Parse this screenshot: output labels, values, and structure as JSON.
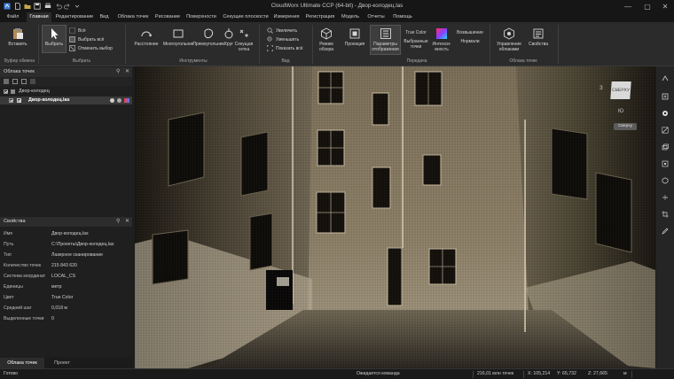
{
  "window": {
    "title": "CloudWorx Ultimate CCP (64-bit) - Двор-колодец.las",
    "minimize": "—",
    "maximize": "▢",
    "close": "✕"
  },
  "menu": {
    "tabs": [
      "Файл",
      "Главная",
      "Редактирование",
      "Вид",
      "Облака точек",
      "Рисование",
      "Поверхности",
      "Секущие плоскости",
      "Измерения",
      "Регистрация",
      "Модель",
      "Отчеты",
      "Помощь"
    ],
    "active": "Главная"
  },
  "ribbon": {
    "clipboard": {
      "paste": "Вставить",
      "group": "Буфер обмена"
    },
    "select": {
      "select": "Выбрать",
      "all": "Всё",
      "select_all": "Выбрать всё",
      "deselect": "Отменить выбор",
      "group": "Выбрать"
    },
    "tools": {
      "distance": "Расстояние",
      "polygon": "Многоугольник",
      "rectangle": "Прямоугольник",
      "circle": "Круг",
      "section_grid": "Секущая сетка",
      "group": "Инструменты"
    },
    "view": {
      "zoom_in": "Увеличить",
      "zoom_out": "Уменьшить",
      "show_all": "Показать всё",
      "group": "Вид"
    },
    "display": {
      "overview": "Режим обзора",
      "projection": "Проекция",
      "display_params": "Параметры отображения",
      "true_color": "True Color",
      "selected_points": "Выбранные точки",
      "intensity": "Интенси-вность",
      "elevation": "Возвышение",
      "normals": "Нормали",
      "group": "Передача"
    },
    "pointclouds": {
      "manage": "Управление облаками",
      "properties": "Свойства",
      "group": "Облака точек"
    }
  },
  "tree_panel": {
    "title": "Облака точек",
    "items": [
      {
        "label": "Двор-колодец",
        "checked": true,
        "level": 0
      },
      {
        "label": "Двор-колодец.las",
        "checked": true,
        "level": 1,
        "selected": true
      }
    ]
  },
  "properties_panel": {
    "title": "Свойства",
    "rows": [
      {
        "key": "Имя",
        "value": "Двор-колодец.las"
      },
      {
        "key": "Путь",
        "value": "C:\\Проекты\\Двор-колодец.las"
      },
      {
        "key": "Тип",
        "value": "Лазерное сканирование"
      },
      {
        "key": "Количество точек",
        "value": "215 843 620"
      },
      {
        "key": "Система координат",
        "value": "LOCAL_CS"
      },
      {
        "key": "Единицы",
        "value": "метр"
      },
      {
        "key": "Цвет",
        "value": "True Color"
      },
      {
        "key": "Средний шаг",
        "value": "0,018 м"
      },
      {
        "key": "Выделенные точки",
        "value": "0"
      }
    ]
  },
  "bottom_tabs": [
    "Облака точек",
    "Проект"
  ],
  "viewcube": {
    "face": "СВЕРХУ",
    "label_s": "Ю",
    "label_w": "З",
    "button": "Сверху"
  },
  "status": {
    "ready": "Готово",
    "waiting": "Ожидается команда",
    "points": "216,01 млн точек",
    "x": "X: 105,214",
    "y": "Y: 65,732",
    "z": "Z: 27,665",
    "units": "м"
  },
  "colors": {
    "accent": "#3f7fd8",
    "background": "#1e1e1e",
    "ribbon": "#2b2b2b",
    "panel": "#1f1f1f"
  }
}
